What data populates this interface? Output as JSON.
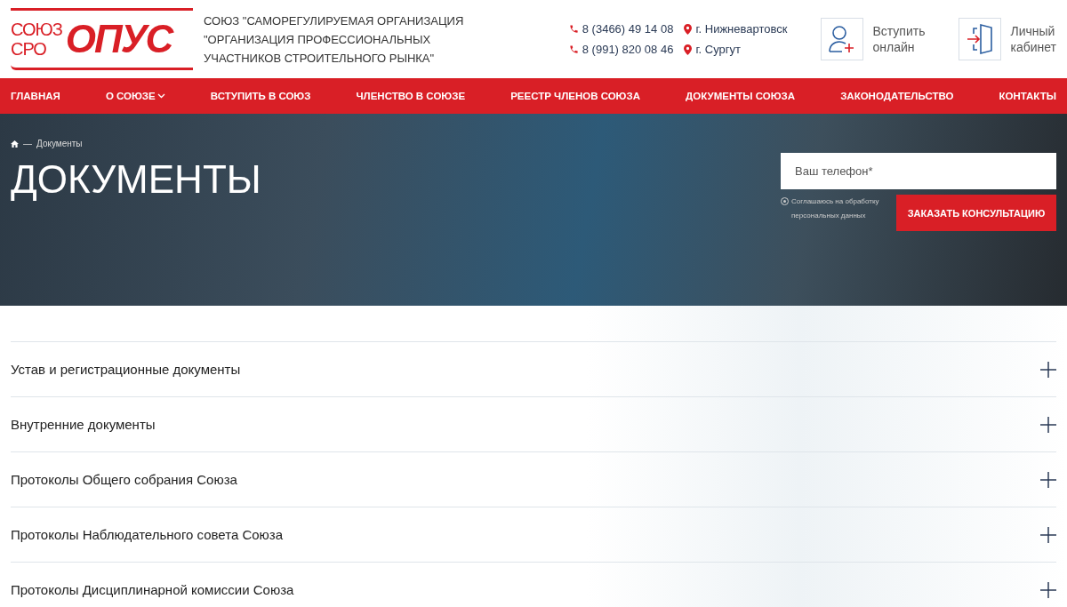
{
  "logo": {
    "left_top": "СОЮЗ",
    "left_bottom": "СРО",
    "main": "ОПУС"
  },
  "org_name": [
    "СОЮЗ \"САМОРЕГУЛИРУЕМАЯ ОРГАНИЗАЦИЯ",
    "\"ОРГАНИЗАЦИЯ ПРОФЕССИОНАЛЬНЫХ",
    "УЧАСТНИКОВ СТРОИТЕЛЬНОГО РЫНКА\""
  ],
  "contacts": [
    {
      "phone": "8 (3466) 49 14 08",
      "city": "г. Нижневартовск"
    },
    {
      "phone": "8 (991) 820 08 46",
      "city": "г. Сургут"
    }
  ],
  "header_actions": [
    {
      "kind": "join",
      "label_1": "Вступить",
      "label_2": "онлайн"
    },
    {
      "kind": "cabinet",
      "label_1": "Личный",
      "label_2": "кабинет"
    }
  ],
  "nav": [
    {
      "label": "ГЛАВНАЯ",
      "has_dropdown": false
    },
    {
      "label": "О СОЮЗЕ",
      "has_dropdown": true
    },
    {
      "label": "ВСТУПИТЬ В СОЮЗ",
      "has_dropdown": false
    },
    {
      "label": "ЧЛЕНСТВО В СОЮЗЕ",
      "has_dropdown": false
    },
    {
      "label": "РЕЕСТР ЧЛЕНОВ СОЮЗА",
      "has_dropdown": false
    },
    {
      "label": "ДОКУМЕНТЫ СОЮЗА",
      "has_dropdown": false
    },
    {
      "label": "ЗАКОНОДАТЕЛЬСТВО",
      "has_dropdown": false
    },
    {
      "label": "КОНТАКТЫ",
      "has_dropdown": false
    }
  ],
  "breadcrumb": {
    "separator": "—",
    "current": "Документы"
  },
  "page_title": "ДОКУМЕНТЫ",
  "consult_form": {
    "placeholder": "Ваш телефон*",
    "consent_line_1": "Соглашаюсь на обработку",
    "consent_line_2": "персональных данных",
    "consent_checked": true,
    "button": "ЗАКАЗАТЬ КОНСУЛЬТАЦИЮ"
  },
  "sections": [
    {
      "title": "Устав и регистрационные документы",
      "expanded": false
    },
    {
      "title": "Внутренние документы",
      "expanded": false
    },
    {
      "title": "Протоколы Общего собрания Союза",
      "expanded": false
    },
    {
      "title": "Протоколы Наблюдательного совета Союза",
      "expanded": false
    },
    {
      "title": "Протоколы Дисциплинарной комиссии Союза",
      "expanded": false
    }
  ]
}
